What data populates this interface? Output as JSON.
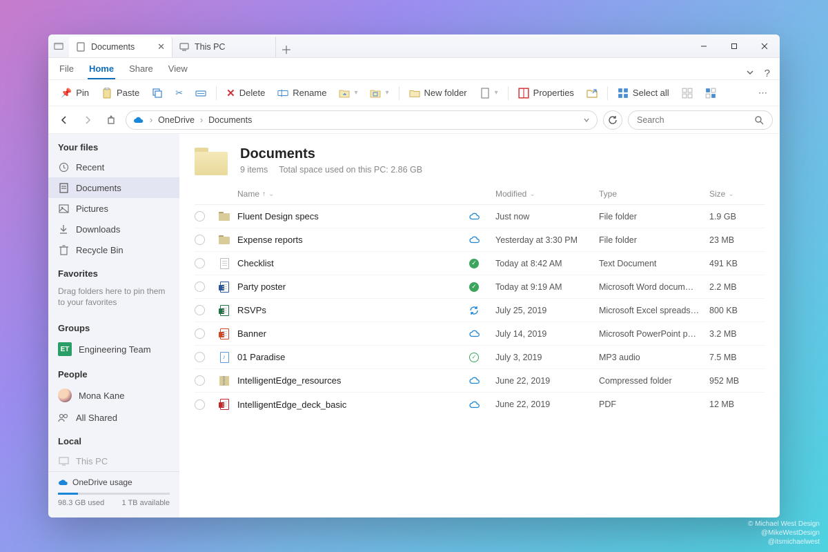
{
  "tabs": [
    {
      "label": "Documents",
      "active": true,
      "closable": true
    },
    {
      "label": "This PC",
      "active": false,
      "closable": false
    }
  ],
  "menubar": {
    "items": [
      "File",
      "Home",
      "Share",
      "View"
    ],
    "active_index": 1
  },
  "ribbon": {
    "pin": "Pin",
    "paste": "Paste",
    "delete": "Delete",
    "rename": "Rename",
    "newfolder": "New folder",
    "properties": "Properties",
    "selectall": "Select all"
  },
  "breadcrumb": [
    "OneDrive",
    "Documents"
  ],
  "search": {
    "placeholder": "Search"
  },
  "sidebar": {
    "your_files_title": "Your files",
    "your_files": [
      {
        "label": "Recent",
        "icon": "clock-icon"
      },
      {
        "label": "Documents",
        "icon": "document-icon",
        "active": true
      },
      {
        "label": "Pictures",
        "icon": "picture-icon"
      },
      {
        "label": "Downloads",
        "icon": "download-icon"
      },
      {
        "label": "Recycle Bin",
        "icon": "trash-icon"
      }
    ],
    "favorites_title": "Favorites",
    "favorites_hint": "Drag folders here to pin them to your favorites",
    "groups_title": "Groups",
    "groups": [
      {
        "badge": "ET",
        "label": "Engineering Team"
      }
    ],
    "people_title": "People",
    "people": [
      {
        "label": "Mona Kane",
        "avatar": true
      },
      {
        "label": "All Shared",
        "icon": "people-icon"
      }
    ],
    "local_title": "Local",
    "local": [
      {
        "label": "This PC",
        "icon": "pc-icon"
      }
    ],
    "usage": {
      "title": "OneDrive usage",
      "used": "98.3 GB used",
      "available": "1 TB available"
    }
  },
  "content": {
    "title": "Documents",
    "count_label": "9 items",
    "space_label": "Total space used on this PC: 2.86 GB",
    "columns": {
      "name": "Name",
      "modified": "Modified",
      "type": "Type",
      "size": "Size"
    },
    "rows": [
      {
        "name": "Fluent Design specs",
        "icon": "folder",
        "status": "cloud",
        "modified": "Just now",
        "type": "File folder",
        "size": "1.9 GB"
      },
      {
        "name": "Expense reports",
        "icon": "folder",
        "status": "cloud",
        "modified": "Yesterday at 3:30 PM",
        "type": "File folder",
        "size": "23 MB"
      },
      {
        "name": "Checklist",
        "icon": "text",
        "status": "check",
        "modified": "Today at 8:42 AM",
        "type": "Text Document",
        "size": "491 KB"
      },
      {
        "name": "Party poster",
        "icon": "word",
        "status": "check",
        "modified": "Today at 9:19 AM",
        "type": "Microsoft Word docum…",
        "size": "2.2 MB"
      },
      {
        "name": "RSVPs",
        "icon": "excel",
        "status": "sync",
        "modified": "July 25, 2019",
        "type": "Microsoft Excel spreads…",
        "size": "800 KB"
      },
      {
        "name": "Banner",
        "icon": "ppt",
        "status": "cloud",
        "modified": "July 14, 2019",
        "type": "Microsoft PowerPoint p…",
        "size": "3.2 MB"
      },
      {
        "name": "01 Paradise",
        "icon": "audio",
        "status": "checkring",
        "modified": "July 3, 2019",
        "type": "MP3 audio",
        "size": "7.5 MB"
      },
      {
        "name": "IntelligentEdge_resources",
        "icon": "zip",
        "status": "cloud",
        "modified": "June 22, 2019",
        "type": "Compressed folder",
        "size": "952 MB"
      },
      {
        "name": "IntelligentEdge_deck_basic",
        "icon": "pdf",
        "status": "cloud",
        "modified": "June 22, 2019",
        "type": "PDF",
        "size": "12 MB"
      }
    ]
  },
  "credit": {
    "line1": "© Michael West Design",
    "line2": "@MikeWestDesign",
    "line3": "@itsmichaelwest"
  }
}
